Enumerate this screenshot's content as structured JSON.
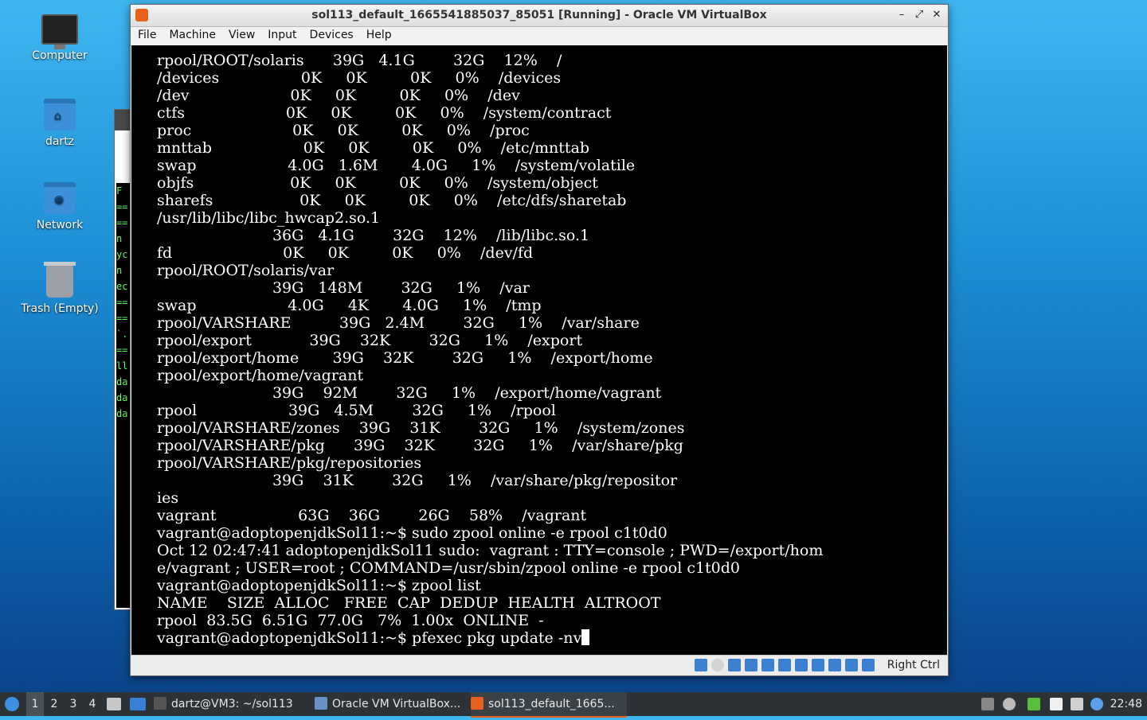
{
  "desktop": {
    "icons": [
      {
        "label": "Computer"
      },
      {
        "label": "dartz"
      },
      {
        "label": "Network"
      },
      {
        "label": "Trash (Empty)"
      }
    ]
  },
  "background_window": {
    "terminal_fragments": [
      "F",
      "==",
      "==",
      "n",
      "yc",
      "n",
      "ec",
      "==",
      "==",
      "`.",
      "==",
      "ll",
      "da",
      "da",
      "da"
    ]
  },
  "window": {
    "title": "sol113_default_1665541885037_85051 [Running] - Oracle VM VirtualBox",
    "controls": {
      "minimize": "–",
      "maximize": "⤢",
      "close": "✕"
    },
    "menu": [
      "File",
      "Machine",
      "View",
      "Input",
      "Devices",
      "Help"
    ],
    "terminal_lines": [
      "rpool/ROOT/solaris      39G   4.1G        32G    12%    /",
      "/devices                 0K     0K         0K     0%    /devices",
      "/dev                     0K     0K         0K     0%    /dev",
      "ctfs                     0K     0K         0K     0%    /system/contract",
      "proc                     0K     0K         0K     0%    /proc",
      "mnttab                   0K     0K         0K     0%    /etc/mnttab",
      "swap                   4.0G   1.6M       4.0G     1%    /system/volatile",
      "objfs                    0K     0K         0K     0%    /system/object",
      "sharefs                  0K     0K         0K     0%    /etc/dfs/sharetab",
      "/usr/lib/libc/libc_hwcap2.so.1",
      "                        36G   4.1G        32G    12%    /lib/libc.so.1",
      "fd                       0K     0K         0K     0%    /dev/fd",
      "rpool/ROOT/solaris/var",
      "                        39G   148M        32G     1%    /var",
      "swap                   4.0G     4K       4.0G     1%    /tmp",
      "rpool/VARSHARE          39G   2.4M        32G     1%    /var/share",
      "rpool/export            39G    32K        32G     1%    /export",
      "rpool/export/home       39G    32K        32G     1%    /export/home",
      "rpool/export/home/vagrant",
      "                        39G    92M        32G     1%    /export/home/vagrant",
      "rpool                   39G   4.5M        32G     1%    /rpool",
      "rpool/VARSHARE/zones    39G    31K        32G     1%    /system/zones",
      "rpool/VARSHARE/pkg      39G    32K        32G     1%    /var/share/pkg",
      "rpool/VARSHARE/pkg/repositories",
      "                        39G    31K        32G     1%    /var/share/pkg/repositor",
      "ies",
      "vagrant                 63G    36G        26G    58%    /vagrant",
      "vagrant@adoptopenjdkSol11:~$ sudo zpool online -e rpool c1t0d0",
      "Oct 12 02:47:41 adoptopenjdkSol11 sudo:  vagrant : TTY=console ; PWD=/export/hom",
      "e/vagrant ; USER=root ; COMMAND=/usr/sbin/zpool online -e rpool c1t0d0",
      "vagrant@adoptopenjdkSol11:~$ zpool list",
      "NAME    SIZE  ALLOC   FREE  CAP  DEDUP  HEALTH  ALTROOT",
      "rpool  83.5G  6.51G  77.0G   7%  1.00x  ONLINE  -"
    ],
    "prompt": "vagrant@adoptopenjdkSol11:~$ ",
    "current_input": "pfexec pkg update -nv",
    "status": {
      "host_key": "Right Ctrl",
      "indicators": [
        "hard-disk-icon",
        "optical-drive-icon",
        "network-icon",
        "usb-icon",
        "shared-folder-icon",
        "display-icon",
        "video-capture-icon",
        "recording-icon",
        "cpu-icon",
        "mouse-integration-icon",
        "keyboard-icon"
      ]
    }
  },
  "taskbar": {
    "workspaces": [
      "1",
      "2",
      "3",
      "4"
    ],
    "active_workspace": "1",
    "tasks": [
      {
        "label": "dartz@VM3: ~/sol113"
      },
      {
        "label": "Oracle VM VirtualBox..."
      },
      {
        "label": "sol113_default_1665..."
      }
    ],
    "clock": "22:48"
  }
}
